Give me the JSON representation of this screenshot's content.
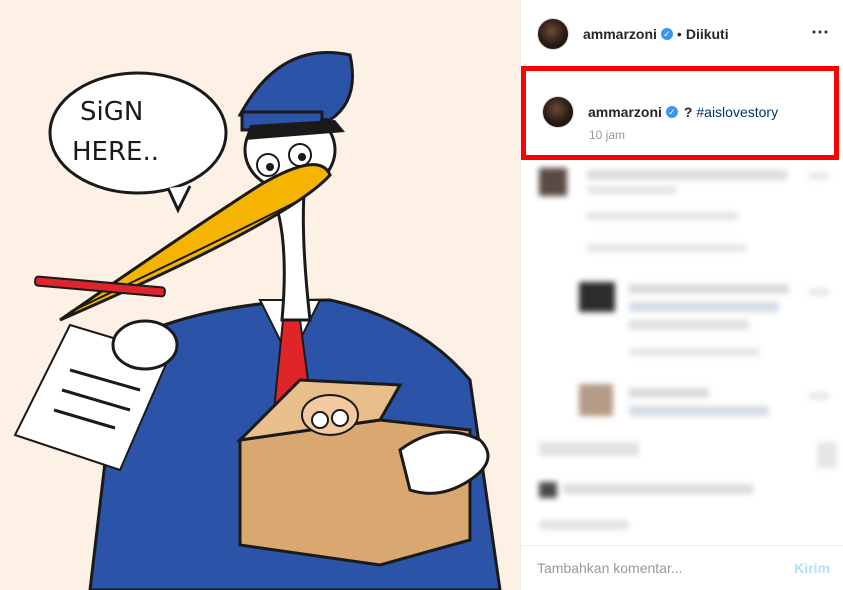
{
  "header": {
    "username": "ammarzoni",
    "verified_icon": "verified-badge-icon",
    "separator": "•",
    "follow_status": "Diikuti",
    "more_icon": "⋯"
  },
  "caption": {
    "username": "ammarzoni",
    "text_mark": "?",
    "hashtag": "#aislovestory",
    "time": "10 jam"
  },
  "cartoon": {
    "speech_line1": "SiGN",
    "speech_line2": "HERE.."
  },
  "comment_bar": {
    "placeholder": "Tambahkan komentar...",
    "post_label": "Kirim"
  },
  "colors": {
    "highlight_border": "#ff0000",
    "verified": "#3897f0",
    "hashtag": "#003569",
    "post_disabled": "#b2dffc"
  }
}
